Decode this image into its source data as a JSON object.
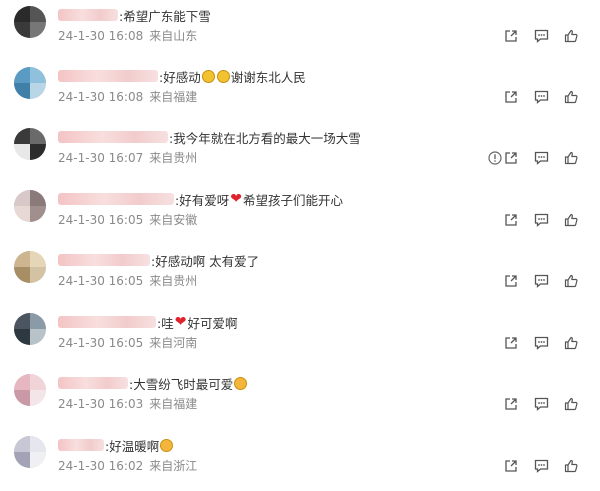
{
  "comments": [
    {
      "text": ":希望广东能下雪",
      "date": "24-1-30 16:08",
      "src": "来自山东",
      "name_w": 60,
      "av": [
        "#2a2a2a",
        "#555",
        "#3a3a3a",
        "#777"
      ]
    },
    {
      "text": ":好感动",
      "text2": "谢谢东北人民",
      "emoji": "cry",
      "date": "24-1-30 16:08",
      "src": "来自福建",
      "name_w": 100,
      "av": [
        "#5a9bc4",
        "#8fc1dc",
        "#3f7fa8",
        "#b8d6e6"
      ]
    },
    {
      "text": ":我今年就在北方看的最大一场大雪",
      "date": "24-1-30 16:07",
      "src": "来自贵州",
      "name_w": 110,
      "av": [
        "#3a3a3a",
        "#6a6a6a",
        "#e8e8e8",
        "#2c2c2c"
      ],
      "warn": true
    },
    {
      "text": ":好有爱呀",
      "text2": " 希望孩子们能开心",
      "heart_mid": true,
      "date": "24-1-30 16:05",
      "src": "来自安徽",
      "name_w": 116,
      "av": [
        "#d8c8c8",
        "#8a7a7a",
        "#e8d8d4",
        "#a08f8c"
      ]
    },
    {
      "text": ":好感动啊 太有爱了",
      "date": "24-1-30 16:05",
      "src": "来自贵州",
      "name_w": 92,
      "av": [
        "#cdb590",
        "#e6d6b8",
        "#a88e65",
        "#d4c3a3"
      ]
    },
    {
      "text": ":哇",
      "text2": "好可爱啊",
      "heart_mid": true,
      "date": "24-1-30 16:05",
      "src": "来自河南",
      "name_w": 98,
      "av": [
        "#4a5560",
        "#8a9aa6",
        "#2e3840",
        "#b7c2c9"
      ]
    },
    {
      "text": ":大雪纷飞时最可爱",
      "emoji": "kiss",
      "date": "24-1-30 16:03",
      "src": "来自福建",
      "name_w": 70,
      "av": [
        "#e6b7c0",
        "#f0d4d8",
        "#c99aa6",
        "#f4e6e8"
      ]
    },
    {
      "text": ":好温暖啊",
      "emoji": "kiss",
      "date": "24-1-30 16:02",
      "src": "来自浙江",
      "name_w": 46,
      "av": [
        "#c7c7d6",
        "#e6e6ee",
        "#a3a3b8",
        "#efeff4"
      ]
    }
  ]
}
